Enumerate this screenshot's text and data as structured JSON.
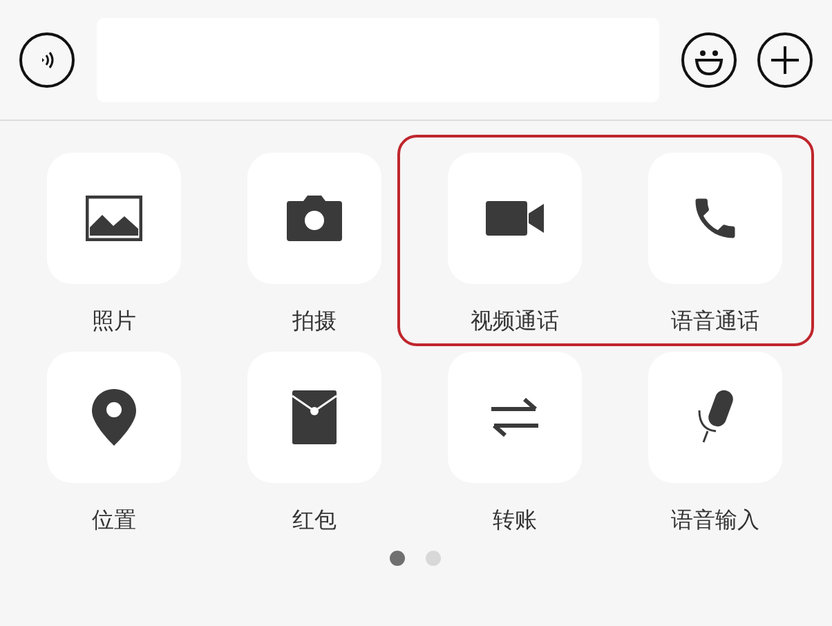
{
  "actions": [
    {
      "label": "照片",
      "highlighted": false
    },
    {
      "label": "拍摄",
      "highlighted": false
    },
    {
      "label": "视频通话",
      "highlighted": true
    },
    {
      "label": "语音通话",
      "highlighted": true
    },
    {
      "label": "位置",
      "highlighted": false
    },
    {
      "label": "红包",
      "highlighted": false
    },
    {
      "label": "转账",
      "highlighted": false
    },
    {
      "label": "语音输入",
      "highlighted": false
    }
  ],
  "pages": [
    {
      "selected": true
    },
    {
      "selected": false
    }
  ]
}
